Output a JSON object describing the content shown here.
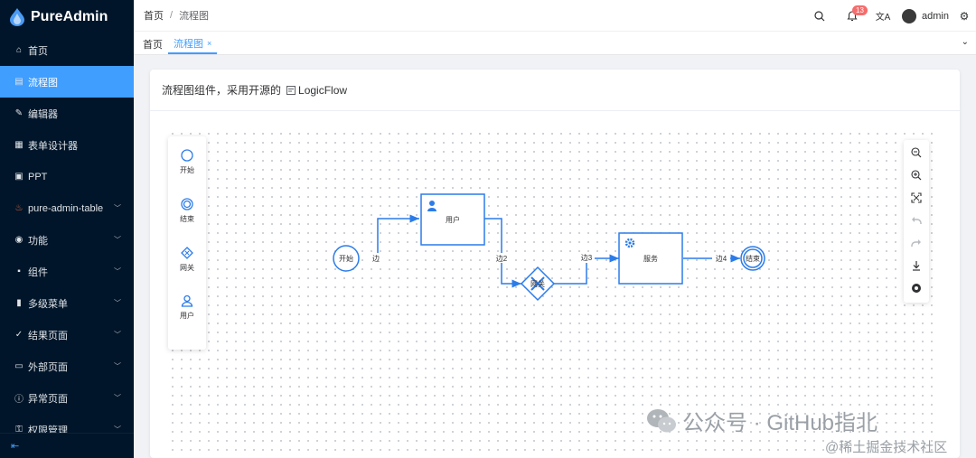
{
  "app": {
    "name": "PureAdmin",
    "brand_color": "#409eff",
    "sidebar_bg": "#001529"
  },
  "sidebar": {
    "items": [
      {
        "label": "首页",
        "icon": "home-icon",
        "expandable": false,
        "active": false
      },
      {
        "label": "流程图",
        "icon": "flowchart-icon",
        "expandable": false,
        "active": true
      },
      {
        "label": "编辑器",
        "icon": "edit-icon",
        "expandable": false,
        "active": false
      },
      {
        "label": "表单设计器",
        "icon": "form-icon",
        "expandable": false,
        "active": false
      },
      {
        "label": "PPT",
        "icon": "ppt-icon",
        "expandable": false,
        "active": false
      },
      {
        "label": "pure-admin-table",
        "icon": "fire-icon",
        "expandable": true,
        "active": false
      },
      {
        "label": "功能",
        "icon": "function-icon",
        "expandable": true,
        "active": false
      },
      {
        "label": "组件",
        "icon": "grid-icon",
        "expandable": true,
        "active": false
      },
      {
        "label": "多级菜单",
        "icon": "bar-chart-icon",
        "expandable": true,
        "active": false
      },
      {
        "label": "结果页面",
        "icon": "check-circle-icon",
        "expandable": true,
        "active": false
      },
      {
        "label": "外部页面",
        "icon": "monitor-icon",
        "expandable": true,
        "active": false
      },
      {
        "label": "异常页面",
        "icon": "info-circle-icon",
        "expandable": true,
        "active": false
      },
      {
        "label": "权限管理",
        "icon": "lock-icon",
        "expandable": true,
        "active": false
      }
    ]
  },
  "breadcrumb": {
    "home": "首页",
    "current": "流程图"
  },
  "header": {
    "notification_count": "13",
    "username": "admin"
  },
  "tabs": [
    {
      "label": "首页",
      "active": false
    },
    {
      "label": "流程图",
      "active": true
    }
  ],
  "card": {
    "title": "流程图组件，采用开源的",
    "link": "LogicFlow"
  },
  "palette": [
    {
      "label": "开始",
      "icon": "circle-icon"
    },
    {
      "label": "结束",
      "icon": "double-circle-icon"
    },
    {
      "label": "网关",
      "icon": "diamond-icon"
    },
    {
      "label": "用户",
      "icon": "user-icon"
    }
  ],
  "flow": {
    "nodes": {
      "start": "开始",
      "user": "用户",
      "gateway": "网关",
      "service": "服务",
      "end": "结束"
    },
    "edges": [
      "边",
      "边2",
      "边3",
      "边4"
    ]
  },
  "controls": [
    "zoom-out-icon",
    "zoom-in-icon",
    "fit-icon",
    "undo-icon",
    "redo-icon",
    "download-icon",
    "minimap-icon"
  ],
  "watermark": {
    "line1": "公众号 · GitHub指北",
    "line2": "@稀土掘金技术社区"
  }
}
